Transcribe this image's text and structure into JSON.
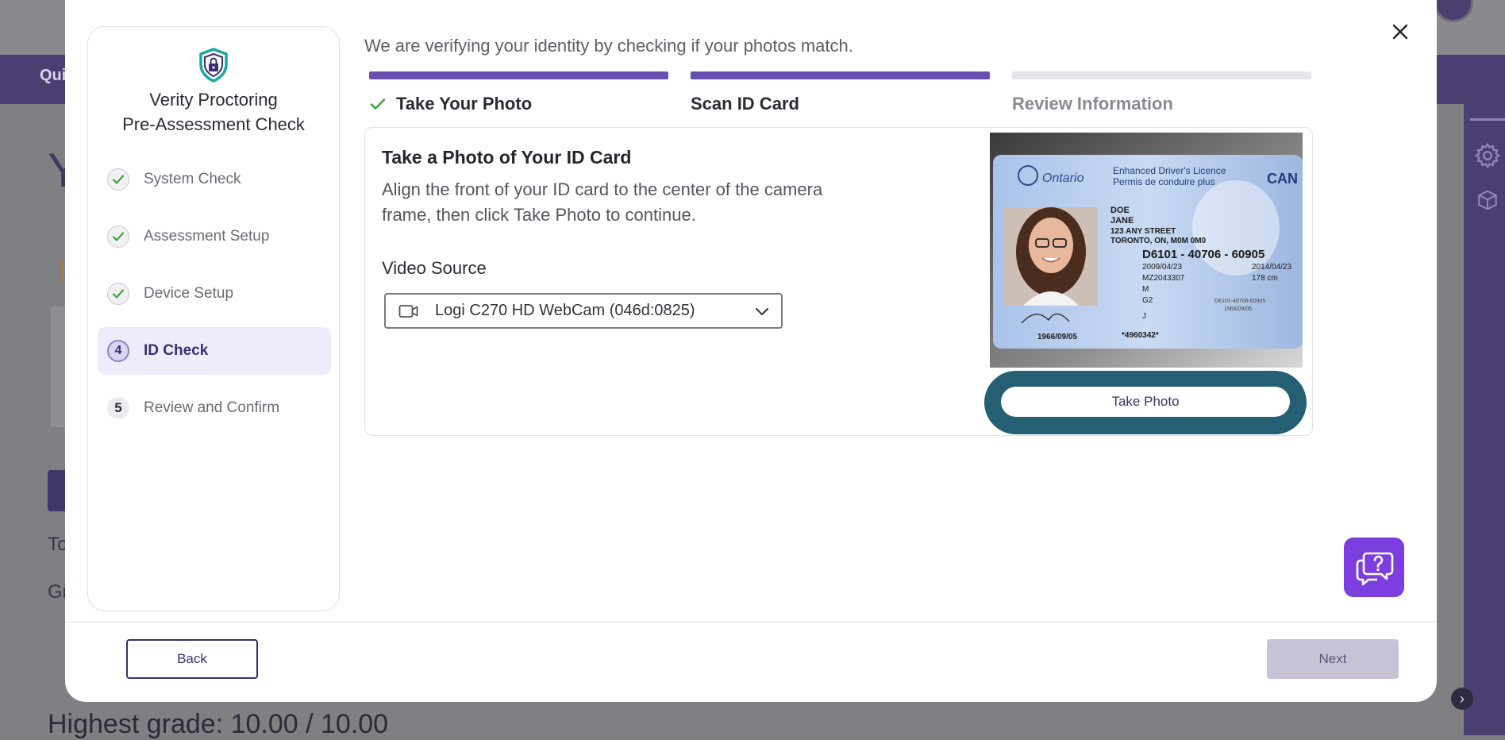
{
  "background": {
    "nav_label": "Qui",
    "heading_initial": "Y",
    "text_to": "To",
    "text_gr": "Gr",
    "highest_grade": "Highest grade: 10.00 / 10.00"
  },
  "sidebar": {
    "title_line1": "Verity Proctoring",
    "title_line2": "Pre-Assessment Check",
    "steps": [
      {
        "marker": "check",
        "label": "System Check",
        "state": "done"
      },
      {
        "marker": "check",
        "label": "Assessment Setup",
        "state": "done"
      },
      {
        "marker": "check",
        "label": "Device Setup",
        "state": "done"
      },
      {
        "marker": "4",
        "label": "ID Check",
        "state": "active"
      },
      {
        "marker": "5",
        "label": "Review and Confirm",
        "state": "pending"
      }
    ]
  },
  "main": {
    "intro": "We are verifying your identity by checking if your photos match.",
    "progress": [
      {
        "label": "Take Your Photo",
        "state": "done"
      },
      {
        "label": "Scan ID Card",
        "state": "current"
      },
      {
        "label": "Review Information",
        "state": "pending"
      }
    ],
    "panel": {
      "title": "Take a Photo of Your ID Card",
      "description": "Align the front of your ID card to the center of the camera frame, then click Take Photo to continue.",
      "video_source_label": "Video Source",
      "video_source_value": "Logi C270 HD WebCam (046d:0825)",
      "take_photo_label": "Take Photo"
    },
    "id_card": {
      "province": "Ontario",
      "licence_en": "Enhanced Driver's Licence",
      "licence_fr": "Permis de conduire plus",
      "country": "CAN",
      "surname": "DOE",
      "given_name": "JANE",
      "address1": "123 ANY STREET",
      "address2": "TORONTO, ON, M0M 0M0",
      "number": "D6101 - 40706 - 60905",
      "issue_date": "2009/04/23",
      "expiry_date": "2014/04/23",
      "ref": "MZ2043307",
      "height": "178 cm",
      "sex": "M",
      "class": "G2",
      "conditions": "J",
      "dob": "1966/09/05",
      "barcode_num": "*4960342*",
      "small_num": "D6101-40706-60905",
      "small_dob": "1966/09/05"
    }
  },
  "footer": {
    "back_label": "Back",
    "next_label": "Next"
  },
  "colors": {
    "accent": "#6a4fb3",
    "progress_pending": "#e6e6ea",
    "take_photo_ring": "#245f73",
    "help": "#7d3ee0",
    "check_green": "#3aa53a"
  },
  "icons": {
    "close": "close-icon",
    "shield": "shield-lock-icon",
    "help": "help-chat-icon",
    "camera": "video-camera-icon",
    "dropdown": "chevron-down-icon"
  }
}
